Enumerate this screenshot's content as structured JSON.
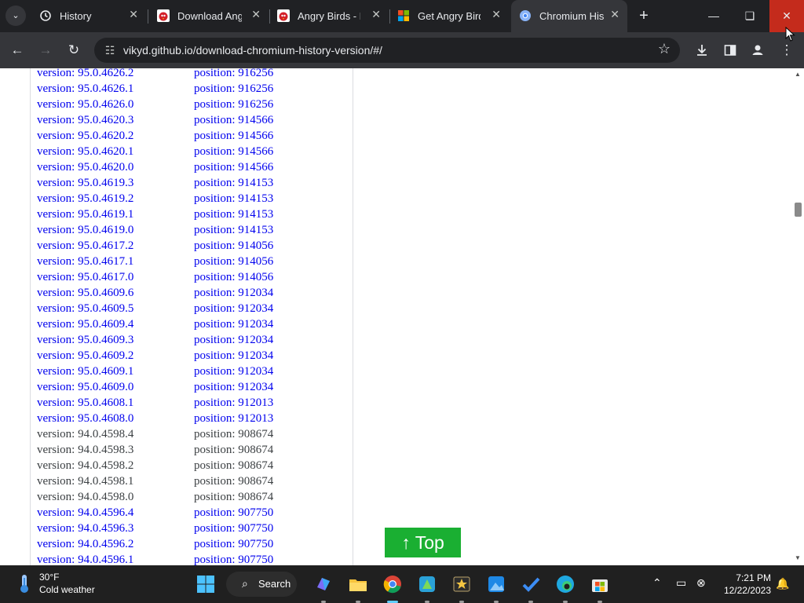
{
  "browser": {
    "tabs": [
      {
        "title": "History",
        "icon": "history-icon"
      },
      {
        "title": "Download Angry Birds",
        "icon": "angry-birds-icon"
      },
      {
        "title": "Angry Birds - Download",
        "icon": "angry-birds-icon"
      },
      {
        "title": "Get Angry Birds",
        "icon": "microsoft-store-icon"
      },
      {
        "title": "Chromium History Versions",
        "icon": "chromium-icon",
        "active": true
      }
    ],
    "url": "vikyd.github.io/download-chromium-history-version/#/"
  },
  "versions": [
    {
      "version": "version: 95.0.4626.2",
      "position": "position: 916256"
    },
    {
      "version": "version: 95.0.4626.1",
      "position": "position: 916256"
    },
    {
      "version": "version: 95.0.4626.0",
      "position": "position: 916256"
    },
    {
      "version": "version: 95.0.4620.3",
      "position": "position: 914566"
    },
    {
      "version": "version: 95.0.4620.2",
      "position": "position: 914566"
    },
    {
      "version": "version: 95.0.4620.1",
      "position": "position: 914566"
    },
    {
      "version": "version: 95.0.4620.0",
      "position": "position: 914566"
    },
    {
      "version": "version: 95.0.4619.3",
      "position": "position: 914153"
    },
    {
      "version": "version: 95.0.4619.2",
      "position": "position: 914153"
    },
    {
      "version": "version: 95.0.4619.1",
      "position": "position: 914153"
    },
    {
      "version": "version: 95.0.4619.0",
      "position": "position: 914153"
    },
    {
      "version": "version: 95.0.4617.2",
      "position": "position: 914056"
    },
    {
      "version": "version: 95.0.4617.1",
      "position": "position: 914056"
    },
    {
      "version": "version: 95.0.4617.0",
      "position": "position: 914056"
    },
    {
      "version": "version: 95.0.4609.6",
      "position": "position: 912034"
    },
    {
      "version": "version: 95.0.4609.5",
      "position": "position: 912034"
    },
    {
      "version": "version: 95.0.4609.4",
      "position": "position: 912034"
    },
    {
      "version": "version: 95.0.4609.3",
      "position": "position: 912034"
    },
    {
      "version": "version: 95.0.4609.2",
      "position": "position: 912034"
    },
    {
      "version": "version: 95.0.4609.1",
      "position": "position: 912034"
    },
    {
      "version": "version: 95.0.4609.0",
      "position": "position: 912034"
    },
    {
      "version": "version: 95.0.4608.1",
      "position": "position: 912013"
    },
    {
      "version": "version: 95.0.4608.0",
      "position": "position: 912013"
    },
    {
      "version": "version: 94.0.4598.4",
      "position": "position: 908674"
    },
    {
      "version": "version: 94.0.4598.3",
      "position": "position: 908674"
    },
    {
      "version": "version: 94.0.4598.2",
      "position": "position: 908674"
    },
    {
      "version": "version: 94.0.4598.1",
      "position": "position: 908674"
    },
    {
      "version": "version: 94.0.4598.0",
      "position": "position: 908674"
    },
    {
      "version": "version: 94.0.4596.4",
      "position": "position: 907750"
    },
    {
      "version": "version: 94.0.4596.3",
      "position": "position: 907750"
    },
    {
      "version": "version: 94.0.4596.2",
      "position": "position: 907750"
    },
    {
      "version": "version: 94.0.4596.1",
      "position": "position: 907750"
    }
  ],
  "page": {
    "top_button": "↑ Top"
  },
  "colors": {
    "link": "#0000ee",
    "visited_text": "#3c4043",
    "top_button": "#1aaf32",
    "titlebar": "#202124",
    "toolbar": "#35363a",
    "close_hover": "#c42b1c"
  },
  "taskbar": {
    "weather_temp": "30°F",
    "weather_desc": "Cold weather",
    "search_label": "Search",
    "time": "7:21 PM",
    "date": "12/22/2023"
  }
}
